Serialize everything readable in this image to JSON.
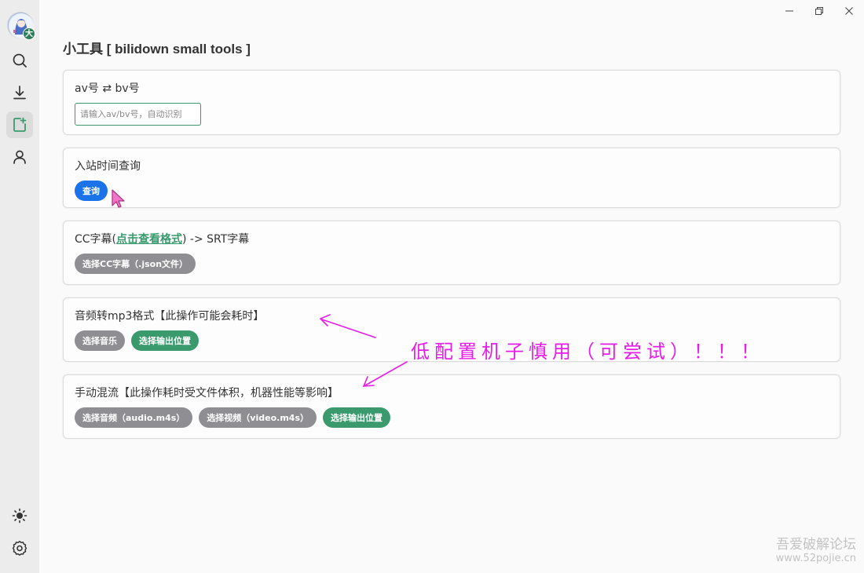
{
  "window": {
    "minimize_icon": "minimize-icon",
    "maximize_icon": "restore-icon",
    "close_icon": "close-icon"
  },
  "sidebar": {
    "avatar_badge": "大",
    "items": [
      {
        "id": "search",
        "icon": "search-icon"
      },
      {
        "id": "download",
        "icon": "download-icon"
      },
      {
        "id": "tools",
        "icon": "tools-icon",
        "active": true
      },
      {
        "id": "user",
        "icon": "user-icon"
      }
    ],
    "bottom": [
      {
        "id": "theme",
        "icon": "sun-icon"
      },
      {
        "id": "settings",
        "icon": "gear-icon"
      }
    ]
  },
  "page": {
    "title": "小工具 [ bilidown small tools ]"
  },
  "cards": {
    "av_bv": {
      "title": "av号 ⇄ bv号",
      "placeholder": "请输入av/bv号，自动识别"
    },
    "join_time": {
      "title": "入站时间查询",
      "button": "查询"
    },
    "cc_srt": {
      "title_prefix": "CC字幕(",
      "title_link": "点击查看格式",
      "title_suffix": ") -> SRT字幕",
      "button": "选择CC字幕（.json文件）"
    },
    "mp3": {
      "title": "音频转mp3格式【此操作可能会耗时】",
      "btn_select": "选择音乐",
      "btn_output": "选择输出位置"
    },
    "mux": {
      "title": "手动混流【此操作耗时受文件体积，机器性能等影响】",
      "btn_audio": "选择音频（audio.m4s）",
      "btn_video": "选择视频（video.m4s）",
      "btn_output": "选择输出位置"
    }
  },
  "annotation": {
    "text": "低配置机子慎用（可尝试）！！！",
    "color": "#e81ce8"
  },
  "watermark": {
    "line1": "吾爱破解论坛",
    "line2": "www.52pojie.cn"
  },
  "colors": {
    "accent_green": "#3a9a6d",
    "blue_button": "#1a73e8",
    "gray_button": "#8e8e93"
  }
}
